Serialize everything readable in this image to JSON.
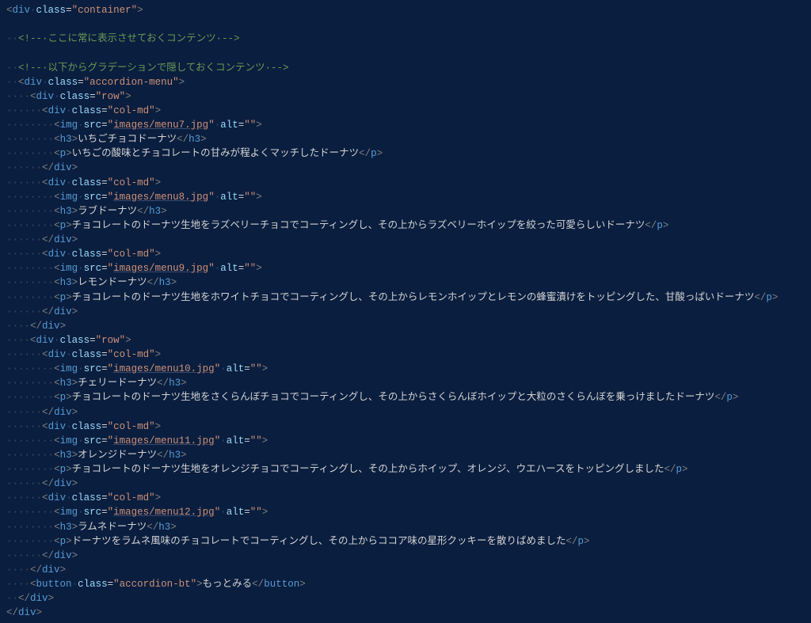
{
  "code": {
    "ws": "·",
    "container_class": "container",
    "comment1": "ここに常に表示させておくコンテンツ",
    "comment2": "以下からグラデーションで隠しておくコンテンツ",
    "accordion_class": "accordion-menu",
    "row_class": "row",
    "col_class": "col-md",
    "button_class": "accordion-bt",
    "button_label": "もっとみる",
    "alt_empty": "",
    "items": [
      {
        "src": "images/menu7.jpg",
        "h3": "いちごチョコドーナツ",
        "p": "いちごの酸味とチョコレートの甘みが程よくマッチしたドーナツ"
      },
      {
        "src": "images/menu8.jpg",
        "h3": "ラブドーナツ",
        "p": "チョコレートのドーナツ生地をラズベリーチョコでコーティングし、その上からラズベリーホイップを絞った可愛らしいドーナツ"
      },
      {
        "src": "images/menu9.jpg",
        "h3": "レモンドーナツ",
        "p": "チョコレートのドーナツ生地をホワイトチョコでコーティングし、その上からレモンホイップとレモンの蜂蜜漬けをトッピングした、甘酸っぱいドーナツ"
      },
      {
        "src": "images/menu10.jpg",
        "h3": "チェリードーナツ",
        "p": "チョコレートのドーナツ生地をさくらんぼチョコでコーティングし、その上からさくらんぼホイップと大粒のさくらんぼを乗っけましたドーナツ"
      },
      {
        "src": "images/menu11.jpg",
        "h3": "オレンジドーナツ",
        "p": "チョコレートのドーナツ生地をオレンジチョコでコーティングし、その上からホイップ、オレンジ、ウエハースをトッピングしました"
      },
      {
        "src": "images/menu12.jpg",
        "h3": "ラムネドーナツ",
        "p": "ドーナツをラムネ風味のチョコレートでコーティングし、その上からココア味の星形クッキーを散りばめました"
      }
    ]
  }
}
